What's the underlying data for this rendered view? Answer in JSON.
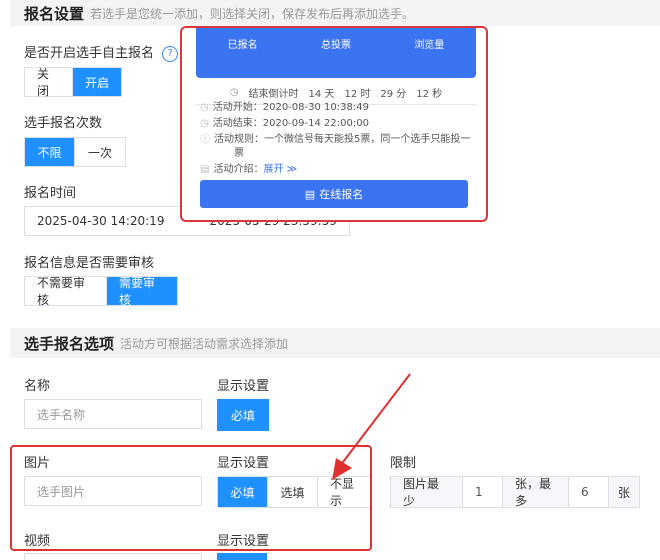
{
  "signup_settings": {
    "title": "报名设置",
    "hint": "若选手是您统一添加，则选择关闭，保存发布后再添加选手。",
    "self_signup": {
      "label": "是否开启选手自主报名",
      "help_icon": "?",
      "options": [
        "关闭",
        "开启"
      ],
      "selected": "开启"
    },
    "signup_count": {
      "label": "选手报名次数",
      "options": [
        "不限",
        "一次"
      ],
      "selected": "不限"
    },
    "signup_time": {
      "label": "报名时间",
      "start": "2025-04-30 14:20:19",
      "end": "2025-05-29 23:59:59"
    },
    "review": {
      "label": "报名信息是否需要审核",
      "options": [
        "不需要审核",
        "需要审核"
      ],
      "selected": "需要审核"
    }
  },
  "preview": {
    "stats": [
      "已报名",
      "总投票",
      "浏览量"
    ],
    "countdown": {
      "label": "结束倒计时",
      "days": "14 天",
      "hours": "12 时",
      "minutes": "29 分",
      "seconds": "12 秒"
    },
    "info": {
      "start": "活动开始：2020-08-30  10:38:49",
      "end": "活动结束：2020-09-14  22:00:00",
      "rule_1": "活动规则：一个微信号每天能投5票，同一个选手只能投一",
      "rule_2": "票",
      "intro": "活动介绍：",
      "expand": "展开"
    },
    "cta": "在线报名"
  },
  "options_section": {
    "title": "选手报名选项",
    "hint": "活动方可根据活动需求选择添加",
    "display_label": "显示设置",
    "limit_label": "限制",
    "name": {
      "label": "名称",
      "placeholder": "选手名称",
      "buttons": [
        "必填"
      ]
    },
    "image": {
      "label": "图片",
      "placeholder": "选手图片",
      "buttons": [
        "必填",
        "选填",
        "不显示"
      ],
      "selected": "必填",
      "limit": {
        "prefix": "图片最少",
        "min": "1",
        "middle": "张，最多",
        "max": "6",
        "suffix": "张"
      }
    },
    "video": {
      "label": "视频"
    }
  },
  "colors": {
    "accent": "#1e90ff",
    "highlight": "#e03131"
  }
}
